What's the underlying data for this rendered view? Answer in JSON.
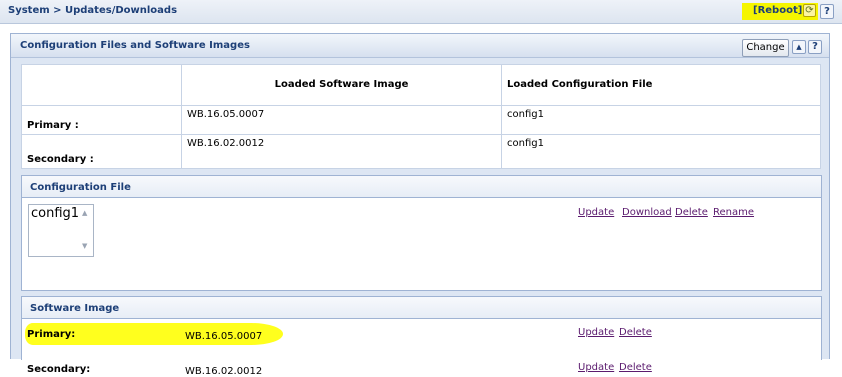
{
  "breadcrumb": "System > Updates/Downloads",
  "toolbar": {
    "reboot_label": "[Reboot]",
    "refresh_icon": "refresh-icon",
    "help_label": "?"
  },
  "panel": {
    "title": "Configuration Files and Software Images",
    "change_label": "Change",
    "collapse_icon": "▲",
    "help_label": "?"
  },
  "loaded_table": {
    "headers": [
      "",
      "Loaded Software Image",
      "Loaded Configuration File"
    ],
    "rows": [
      {
        "label": "Primary :",
        "image": "WB.16.05.0007",
        "config": "config1"
      },
      {
        "label": "Secondary :",
        "image": "WB.16.02.0012",
        "config": "config1"
      }
    ]
  },
  "config_file": {
    "title": "Configuration File",
    "items": [
      "config1"
    ],
    "actions": [
      "Update",
      "Download",
      "Delete",
      "Rename"
    ]
  },
  "software_image": {
    "title": "Software Image",
    "rows": [
      {
        "label": "Primary:",
        "value": "WB.16.05.0007",
        "actions": [
          "Update",
          "Delete"
        ]
      },
      {
        "label": "Secondary:",
        "value": "WB.16.02.0012",
        "actions": [
          "Update",
          "Delete"
        ]
      }
    ]
  },
  "colors": {
    "highlight": "#ffff1e",
    "header_text": "#1d3f77",
    "link": "#5b1b6e",
    "panel_bg": "#dde6f3"
  }
}
